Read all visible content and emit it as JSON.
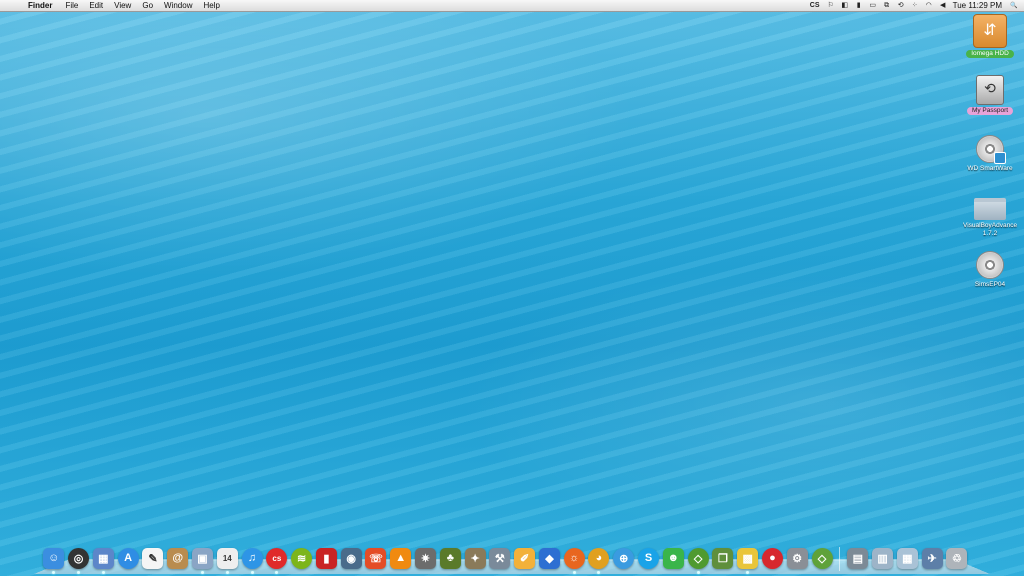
{
  "menubar": {
    "apple": "",
    "app_name": "Finder",
    "menus": [
      "File",
      "Edit",
      "View",
      "Go",
      "Window",
      "Help"
    ],
    "status_icons": [
      "cs-icon",
      "notification-icon",
      "dropbox-icon",
      "battery-status-icon",
      "display-icon",
      "display-mirror-icon",
      "time-machine-icon",
      "dots-icon",
      "wifi-icon",
      "volume-icon"
    ],
    "cs_label": "CS",
    "clock": "Tue 11:29 PM",
    "search_glyph": "🔍"
  },
  "desktop": {
    "icons": [
      {
        "label": "Iomega HDD",
        "kind": "external-drive"
      },
      {
        "label": "My Passport",
        "kind": "time-machine-drive"
      },
      {
        "label": "WD SmartWare",
        "kind": "disc"
      },
      {
        "label": "VisualBoyAdvance 1.7.2",
        "kind": "folder"
      },
      {
        "label": "SimsEP04",
        "kind": "disc"
      }
    ]
  },
  "dock": {
    "apps": [
      {
        "name": "finder",
        "glyph": "☺",
        "color": "#3b8ee0",
        "running": true
      },
      {
        "name": "dashboard",
        "glyph": "◎",
        "color": "#333333",
        "running": true
      },
      {
        "name": "mission-control",
        "glyph": "▦",
        "color": "#5c86c9",
        "running": true
      },
      {
        "name": "app-store",
        "glyph": "A",
        "color": "#2f8de4",
        "running": false
      },
      {
        "name": "textedit",
        "glyph": "✎",
        "color": "#f5f5f5",
        "running": false
      },
      {
        "name": "contacts",
        "glyph": "@",
        "color": "#b98c4f",
        "running": false
      },
      {
        "name": "preview",
        "glyph": "▣",
        "color": "#8aa5c5",
        "running": true
      },
      {
        "name": "calendar",
        "glyph": "14",
        "color": "#eeeeee",
        "running": true
      },
      {
        "name": "itunes",
        "glyph": "♫",
        "color": "#2e95e6",
        "running": true
      },
      {
        "name": "lastfm",
        "glyph": "cs",
        "color": "#e02a2a",
        "running": true
      },
      {
        "name": "spotify",
        "glyph": "≋",
        "color": "#7cb51b",
        "running": false
      },
      {
        "name": "photo-booth",
        "glyph": "▮",
        "color": "#c92424",
        "running": false
      },
      {
        "name": "iphoto",
        "glyph": "◉",
        "color": "#4a6b8a",
        "running": false
      },
      {
        "name": "messages",
        "glyph": "☏",
        "color": "#e44d26",
        "running": false
      },
      {
        "name": "vlc",
        "glyph": "▲",
        "color": "#f08a10",
        "running": false
      },
      {
        "name": "pinwheel",
        "glyph": "✷",
        "color": "#6c6c6c",
        "running": false
      },
      {
        "name": "game-app",
        "glyph": "♣",
        "color": "#5a7a2a",
        "running": false
      },
      {
        "name": "gimp",
        "glyph": "✦",
        "color": "#8a7a5a",
        "running": false
      },
      {
        "name": "xcode-tools",
        "glyph": "⚒",
        "color": "#7a8a9a",
        "running": false
      },
      {
        "name": "pages",
        "glyph": "✐",
        "color": "#f2b13a",
        "running": false
      },
      {
        "name": "xcode",
        "glyph": "◆",
        "color": "#2d6fd2",
        "running": false
      },
      {
        "name": "firefox",
        "glyph": "☼",
        "color": "#e8661f",
        "running": true
      },
      {
        "name": "chrome",
        "glyph": "◕",
        "color": "#e0a020",
        "running": true
      },
      {
        "name": "safari",
        "glyph": "⊕",
        "color": "#3a9be0",
        "running": false
      },
      {
        "name": "skype",
        "glyph": "S",
        "color": "#1aa3e8",
        "running": false
      },
      {
        "name": "messenger",
        "glyph": "☻",
        "color": "#3ab54a",
        "running": false
      },
      {
        "name": "sims",
        "glyph": "◇",
        "color": "#4f9a30",
        "running": true
      },
      {
        "name": "notebook",
        "glyph": "❐",
        "color": "#5f8f3c",
        "running": false
      },
      {
        "name": "sims-expansion",
        "glyph": "▩",
        "color": "#e9c53a",
        "running": true
      },
      {
        "name": "angry-birds",
        "glyph": "●",
        "color": "#d7282e",
        "running": false
      },
      {
        "name": "system-preferences",
        "glyph": "⚙",
        "color": "#8a8f96",
        "running": false
      },
      {
        "name": "sims-launcher",
        "glyph": "◇",
        "color": "#5fa23a",
        "running": false
      }
    ],
    "stacks": [
      {
        "name": "applications-stack",
        "glyph": "▤",
        "color": "#7c8a96"
      },
      {
        "name": "documents-stack",
        "glyph": "▥",
        "color": "#9db4c8"
      },
      {
        "name": "downloads-stack",
        "glyph": "▦",
        "color": "#a9c2d6"
      },
      {
        "name": "utilities-stack",
        "glyph": "✈",
        "color": "#5d7fa8"
      },
      {
        "name": "trash",
        "glyph": "♲",
        "color": "#aeb4ba"
      }
    ]
  },
  "accent": {
    "menu_bar": "#e6e6e6",
    "water": "#1e9fd3",
    "label_green": "#49b34a",
    "label_pink": "#e7a3d8"
  }
}
